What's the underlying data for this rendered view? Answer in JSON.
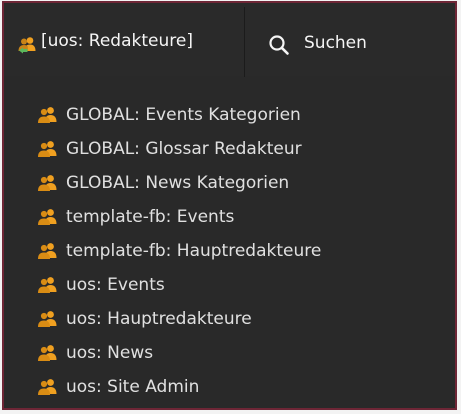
{
  "header": {
    "group_dropdown_label": "[uos: Redakteure]",
    "group_icon": "users-switch-icon",
    "search_icon": "search-icon",
    "search_label": "Suchen"
  },
  "group_list": {
    "item_icon": "user-group-icon",
    "items": [
      {
        "label": "GLOBAL: Events Kategorien"
      },
      {
        "label": "GLOBAL: Glossar Redakteur"
      },
      {
        "label": "GLOBAL: News Kategorien"
      },
      {
        "label": "template-fb: Events"
      },
      {
        "label": "template-fb: Hauptredakteure"
      },
      {
        "label": "uos: Events"
      },
      {
        "label": "uos: Hauptredakteure"
      },
      {
        "label": "uos: News"
      },
      {
        "label": "uos: Site Admin"
      }
    ]
  },
  "colors": {
    "background": "#292929",
    "border": "#6e2636",
    "text": "#e0e0e0",
    "icon_orange": "#f0a020",
    "icon_green": "#5cb85c"
  }
}
